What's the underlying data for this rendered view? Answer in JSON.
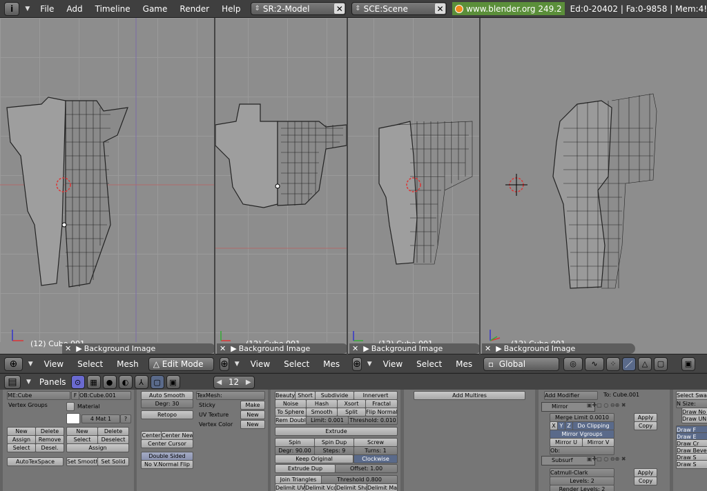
{
  "topbar": {
    "info_icon": "info-icon",
    "menus": [
      "File",
      "Add",
      "Timeline",
      "Game",
      "Render",
      "Help"
    ],
    "screen": "SR:2-Model",
    "scene": "SCE:Scene",
    "weblink": "www.blender.org 249.2",
    "stats": "Ed:0-20402 | Fa:0-9858 | Mem:4!"
  },
  "viewports": [
    {
      "label": "(12) Cube.001",
      "bgimage": "Background Image",
      "menus": [
        "View",
        "Select",
        "Mesh"
      ],
      "mode": "Edit Mode"
    },
    {
      "label": "(12) Cube.001",
      "bgimage": "Background Image",
      "menus": [
        "View",
        "Select",
        "Mes"
      ]
    },
    {
      "label": "(12) Cube.001",
      "bgimage": "Background Image",
      "menus": [
        "View",
        "Select",
        "Mes"
      ]
    },
    {
      "label": "(12) Cube.001",
      "bgimage": "Background Image",
      "orient": "Global"
    }
  ],
  "buttons_header": {
    "panels_label": "Panels",
    "frame": "12"
  },
  "link_panel": {
    "me_field": "ME:Cube",
    "f_btn": "F",
    "ob_field": "OB:Cube.001",
    "vertex_groups": "Vertex Groups",
    "material": "Material",
    "mat_field": "4 Mat 1",
    "q": "?",
    "new1": "New",
    "delete1": "Delete",
    "new2": "New",
    "delete2": "Delete",
    "assign1": "Assign",
    "remove": "Remove",
    "select1": "Select",
    "deselect1": "Deselect",
    "select2": "Select",
    "desel": "Desel.",
    "assign2": "Assign",
    "autotexspace": "AutoTexSpace",
    "set_smooth": "Set Smooth",
    "set_solid": "Set Solid"
  },
  "mesh_panel": {
    "auto_smooth": "Auto Smooth",
    "degr": "Degr: 30",
    "retopo": "Retopo",
    "texmesh": "TexMesh:",
    "sticky": "Sticky",
    "make": "Make",
    "uv_texture": "UV Texture",
    "new_uv": "New",
    "vertex_color": "Vertex Color",
    "new_vc": "New",
    "center": "Center",
    "center_new": "Center New",
    "center_cursor": "Center Cursor",
    "double_sided": "Double Sided",
    "no_v_normal_flip": "No V.Normal Flip"
  },
  "tools_panel": {
    "row1": [
      "Beauty",
      "Short",
      "Subdivide",
      "Innervert"
    ],
    "row2": [
      "Noise",
      "Hash",
      "Xsort",
      "Fractal"
    ],
    "row3": [
      "To Sphere",
      "Smooth",
      "Split",
      "Flip Normal"
    ],
    "row4": [
      "Rem Doubl",
      "Limit: 0.001",
      "Threshold: 0.010"
    ],
    "extrude": "Extrude",
    "spin": "Spin",
    "spin_dup": "Spin Dup",
    "screw": "Screw",
    "degr": "Degr: 90.00",
    "steps": "Steps: 9",
    "turns": "Turns: 1",
    "keep_original": "Keep Original",
    "clockwise": "Clockwise",
    "extrude_dup": "Extrude Dup",
    "offset": "Offset: 1.00",
    "join_triangles": "Join Triangles",
    "threshold": "Threshold 0.800",
    "delimit": [
      "Delimit UV",
      "Delimit Vco",
      "Delimit Sha",
      "Delimit Ma"
    ]
  },
  "multires_panel": {
    "add_multires": "Add Multires"
  },
  "modifiers_panel": {
    "add_modifier": "Add Modifier",
    "to": "To: Cube.001",
    "mirror": "Mirror",
    "apply": "Apply",
    "copy": "Copy",
    "merge_limit": "Merge Limit 0.0010",
    "x": "X",
    "y": "Y",
    "z": "Z",
    "do_clipping": "Do Clipping",
    "mirror_vgroups": "Mirror Vgroups",
    "mirror_u": "Mirror U",
    "mirror_v": "Mirror V",
    "ob": "Ob:",
    "subsurf": "Subsurf",
    "catmull": "Catmull-Clark",
    "levels": "Levels: 2",
    "render_levels": "Render Levels: 2",
    "apply2": "Apply",
    "copy2": "Copy"
  },
  "right_panel": {
    "select_swap": "Select Swa",
    "nsize": "N Size:",
    "draw_no": "Draw No",
    "draw_un": "Draw UN",
    "draw_f": "Draw F",
    "draw_e": "Draw E",
    "draw_cr": "Draw Cr",
    "draw_beve": "Draw Beve",
    "draw_s": "Draw S",
    "draw_s2": "Draw S"
  }
}
